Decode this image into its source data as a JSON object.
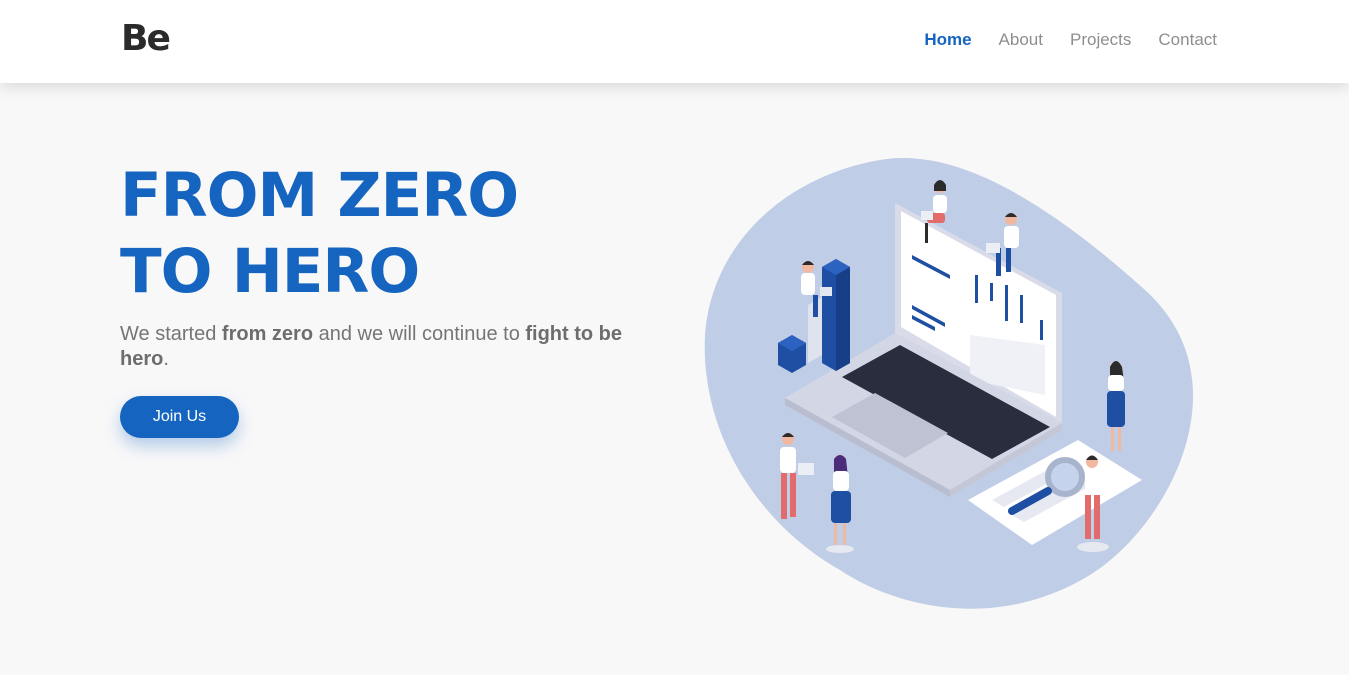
{
  "nav": {
    "logo": "Be",
    "links": [
      {
        "label": "Home",
        "active": true
      },
      {
        "label": "About",
        "active": false
      },
      {
        "label": "Projects",
        "active": false
      },
      {
        "label": "Contact",
        "active": false
      }
    ]
  },
  "hero": {
    "title_line1": "FROM ZERO",
    "title_line2": "TO HERO",
    "text_part1": "We started ",
    "text_bold1": "from zero",
    "text_part2": " and we will continue to ",
    "text_bold2": "fight to be hero",
    "text_part3": ".",
    "button_label": "Join Us"
  },
  "colors": {
    "accent": "#1565c0",
    "blob": "#c0cde6",
    "background": "#f8f8f9"
  }
}
